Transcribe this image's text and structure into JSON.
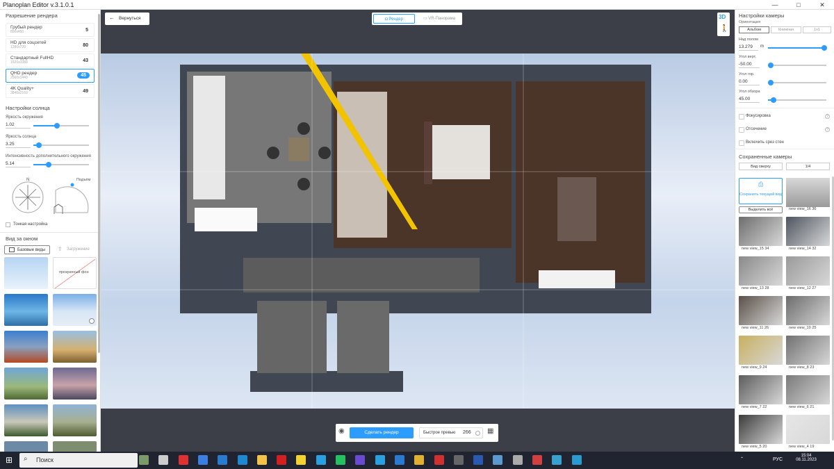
{
  "window": {
    "title": "Planoplan Editor v.3.1.0.1",
    "minimize": "—",
    "maximize": "□",
    "close": "✕"
  },
  "left": {
    "render_section": "Разрешение рендера",
    "resolutions": [
      {
        "name": "Грубый рендер",
        "dims": "800x450",
        "value": "5"
      },
      {
        "name": "HD для соцсетей",
        "dims": "1280x720",
        "value": "80"
      },
      {
        "name": "Стандартный FullHD",
        "dims": "1920x1080",
        "value": "43"
      },
      {
        "name": "QHD рендер",
        "dims": "2560x1440",
        "value": "45"
      },
      {
        "name": "4K Quality+",
        "dims": "3840x2160",
        "value": "49"
      }
    ],
    "sun_section": "Настройки солнца",
    "ambient_label": "Яркость окружения",
    "ambient_value": "1.02",
    "ambient_level": 0.42,
    "sun_label": "Яркость солнца",
    "sun_value": "3.25",
    "sun_level": 0.1,
    "extra_label": "Интенсивность дополнительного окружения",
    "extra_value": "5.14",
    "extra_level": 0.28,
    "compass_n": "N",
    "elevation_label": "Подъём",
    "fine_tune": "Тонкая настройка",
    "window_section": "Вид за окном",
    "tab_basic": "Базовые виды",
    "tab_upload": "Загружение",
    "transparent_bg": "прозрачный фон"
  },
  "center": {
    "back": "Вернуться",
    "tab_render": "Рендер",
    "tab_vr": "VR-Панорама",
    "badge_3d": "3D",
    "render_button": "Сделать рендер",
    "preview_label": "Быстрое превью",
    "preview_value": "266"
  },
  "right": {
    "camera_section": "Настройки камеры",
    "orientation_label": "Ориентация",
    "orient_options": [
      "Альбом",
      "Книжная",
      "1x1"
    ],
    "height_label": "Над полом",
    "height_value": "13.279",
    "height_unit": "m",
    "height_level": 0.97,
    "vert_label": "Угол верт.",
    "vert_value": "-50.00",
    "vert_level": 0.05,
    "hor_label": "Угол гор.",
    "hor_value": "0.00",
    "hor_level": 0.05,
    "fov_label": "Угол обзора",
    "fov_value": "45.00",
    "fov_level": 0.1,
    "focus": "Фокусировка",
    "clipping": "Отсечение",
    "top_cut": "Включить срез стен",
    "saved_section": "Сохраненные камеры",
    "top_view": "Вид сверху",
    "pages": "1/4",
    "save_current": "Сохранить текущий вид",
    "select_all": "Выделить всё",
    "cameras": [
      "new view_16 36",
      "new view_15 34",
      "new view_14 32",
      "new view_13 28",
      "new view_12 27",
      "new view_11 26",
      "new view_10 25",
      "new view_9 24",
      "new view_8 23",
      "new view_7 22",
      "new view_6 21",
      "new view_5 20",
      "new view_4 19"
    ]
  },
  "taskbar": {
    "search": "Поиск",
    "lang": "РУС",
    "time": "15:04",
    "date": "08.11.2023"
  }
}
